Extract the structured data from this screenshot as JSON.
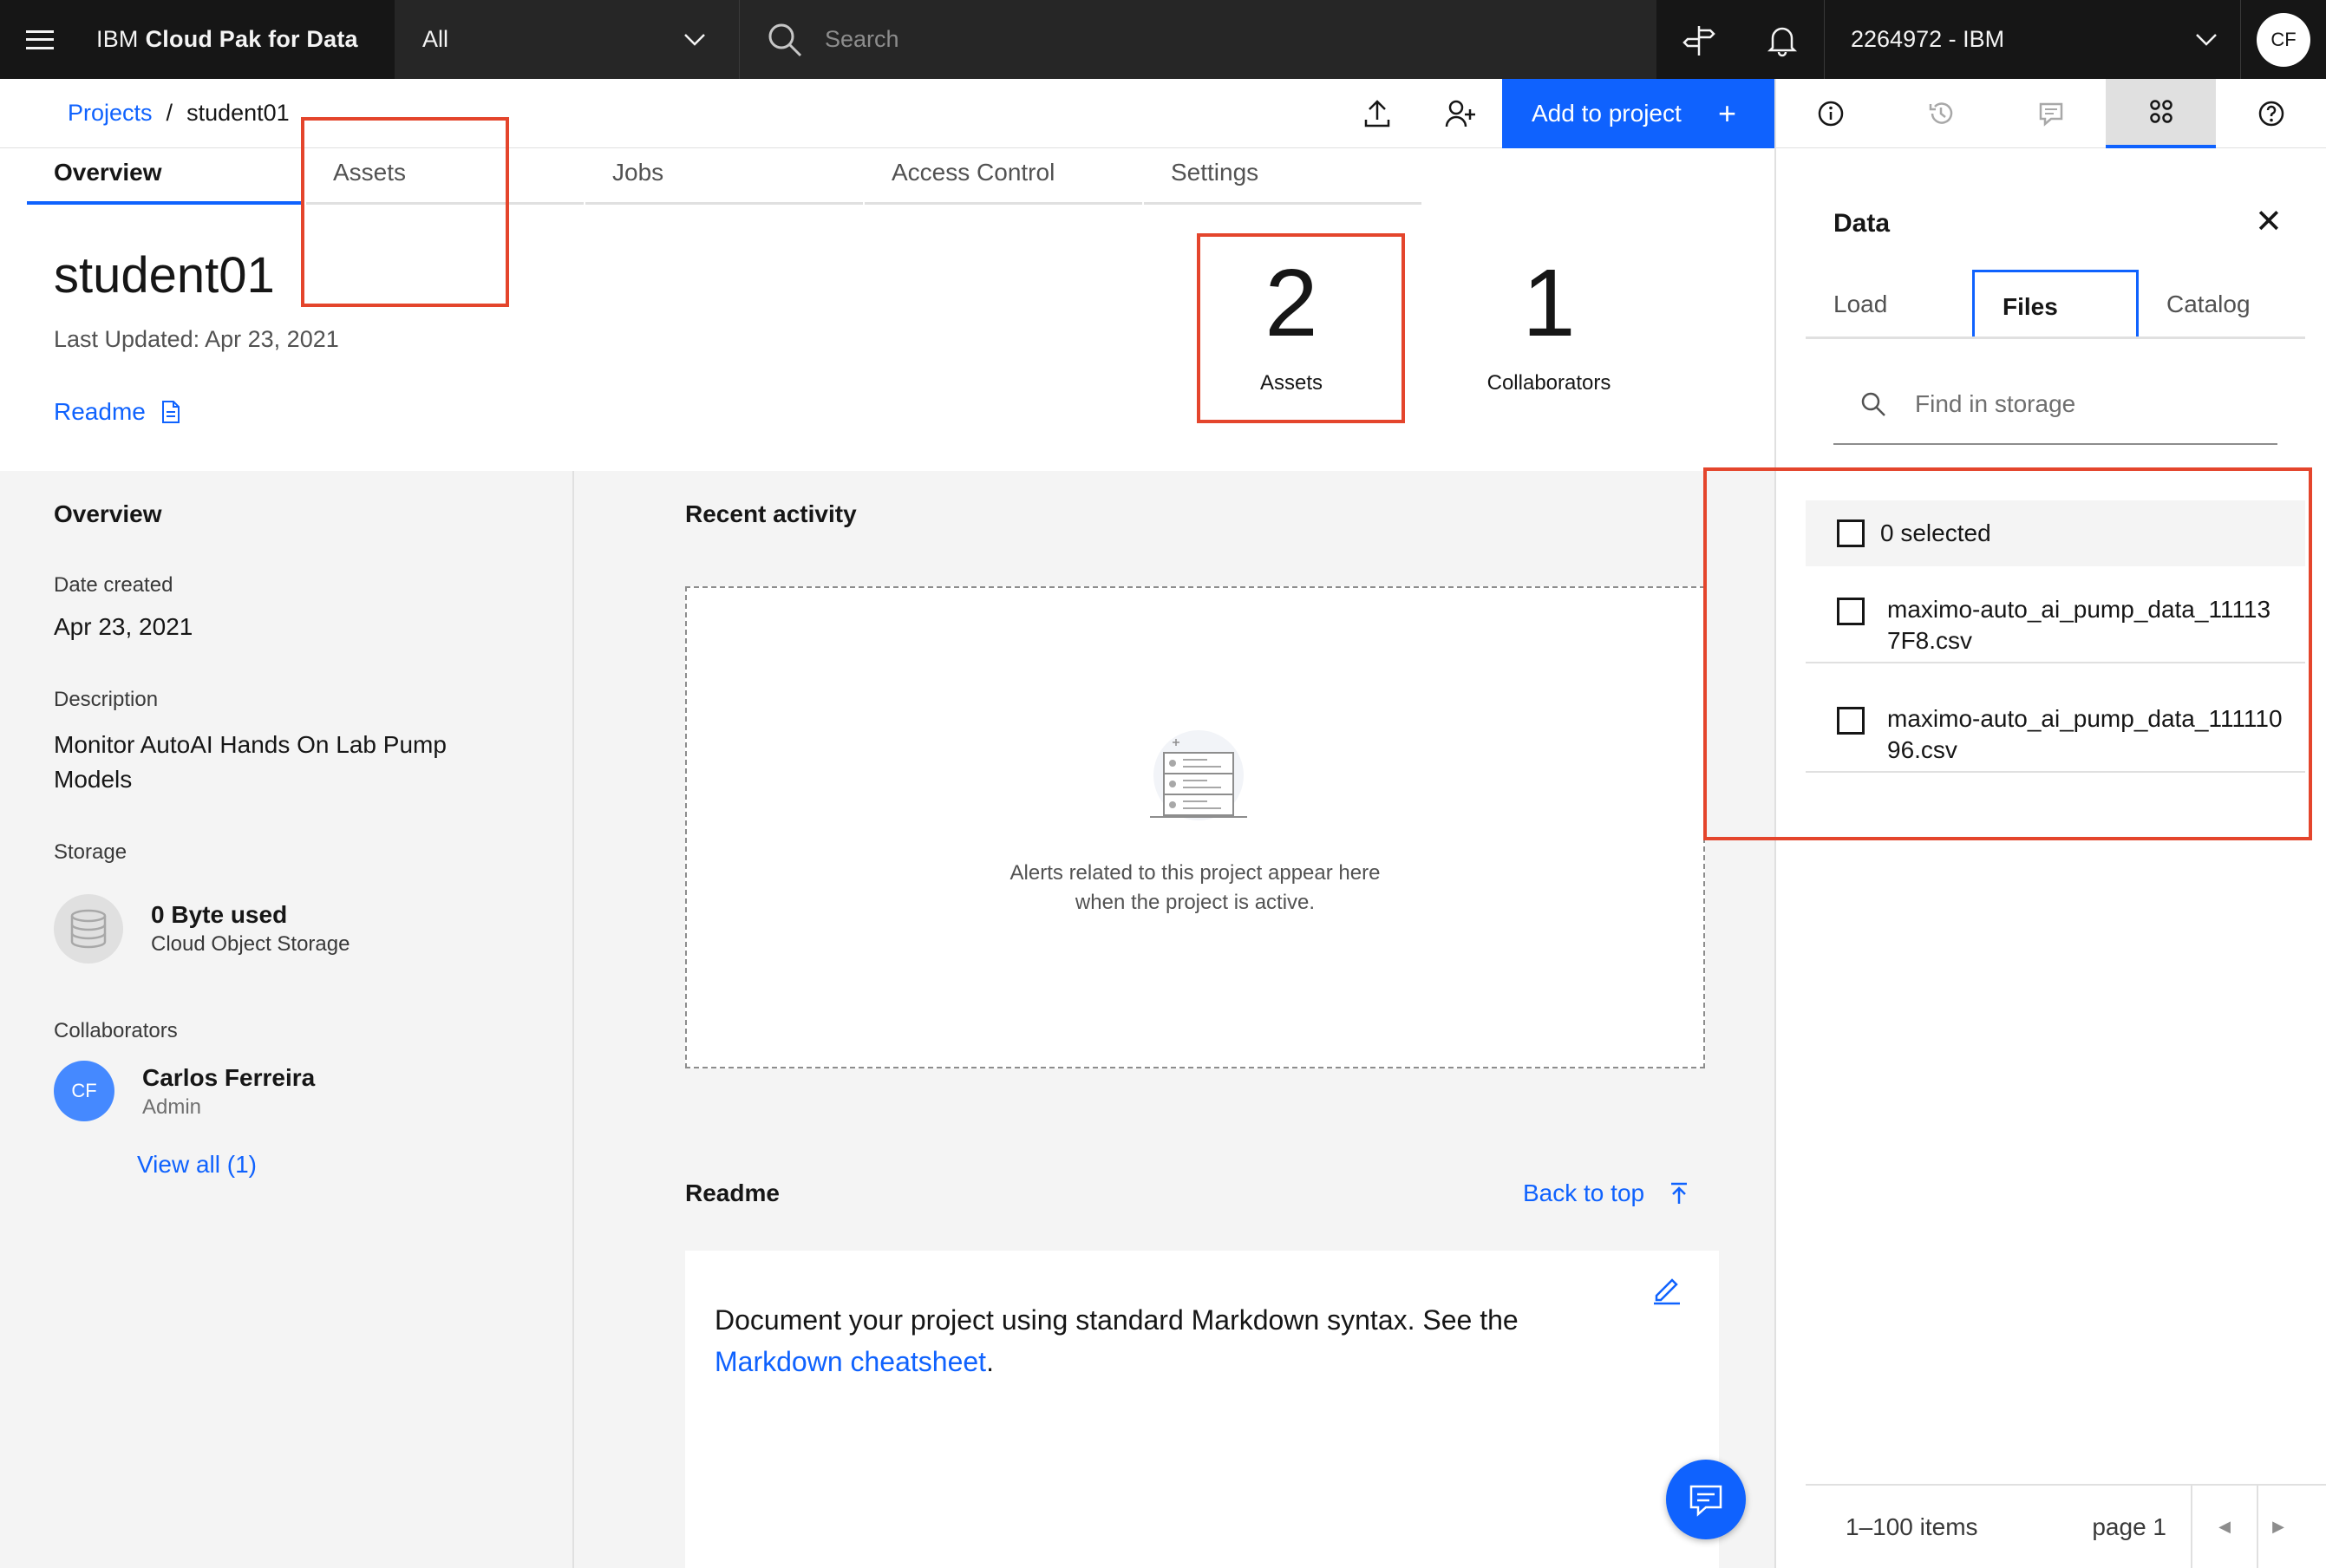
{
  "shell": {
    "brand_light": "IBM",
    "brand_bold": "Cloud Pak for Data",
    "scope": "All",
    "search_placeholder": "Search",
    "account": "2264972 - IBM",
    "avatar": "CF"
  },
  "breadcrumb": {
    "parent": "Projects",
    "separator": "/",
    "current": "student01"
  },
  "toolbar": {
    "add_label": "Add to project",
    "add_symbol": "+"
  },
  "tabs": [
    {
      "label": "Overview"
    },
    {
      "label": "Assets"
    },
    {
      "label": "Jobs"
    },
    {
      "label": "Access Control"
    },
    {
      "label": "Settings"
    }
  ],
  "project": {
    "title": "student01",
    "last_updated": "Last Updated: Apr 23, 2021",
    "readme_link": "Readme"
  },
  "stats": {
    "assets_count": "2",
    "assets_label": "Assets",
    "collab_count": "1",
    "collab_label": "Collaborators"
  },
  "overview": {
    "heading": "Overview",
    "date_label": "Date created",
    "date_value": "Apr 23, 2021",
    "desc_label": "Description",
    "desc_value": "Monitor AutoAI Hands On Lab Pump Models",
    "storage_label": "Storage",
    "storage_used": "0 Byte used",
    "storage_kind": "Cloud Object Storage",
    "collab_label": "Collaborators",
    "collab_initials": "CF",
    "collab_name": "Carlos Ferreira",
    "collab_role": "Admin",
    "view_all": "View all (1)"
  },
  "activity": {
    "heading": "Recent activity",
    "empty_line1": "Alerts related to this project appear here",
    "empty_line2": "when the project is active."
  },
  "readme": {
    "heading": "Readme",
    "back_to_top": "Back to top",
    "text_before": "Document your project using standard Markdown syntax. See the",
    "link": "Markdown cheatsheet",
    "text_after": "."
  },
  "panel": {
    "title": "Data",
    "close": "✕",
    "tabs": [
      {
        "label": "Load"
      },
      {
        "label": "Files"
      },
      {
        "label": "Catalog"
      }
    ],
    "search_placeholder": "Find in storage",
    "selected": "0 selected",
    "files": [
      {
        "name": "maximo-auto_ai_pump_data_111137F8.csv"
      },
      {
        "name": "maximo-auto_ai_pump_data_11111096.csv"
      }
    ],
    "footer_items": "1–100 items",
    "footer_page": "page 1"
  },
  "colors": {
    "accent": "#0f62fe",
    "shell_bg": "#161616",
    "annotation": "#e4452c"
  }
}
